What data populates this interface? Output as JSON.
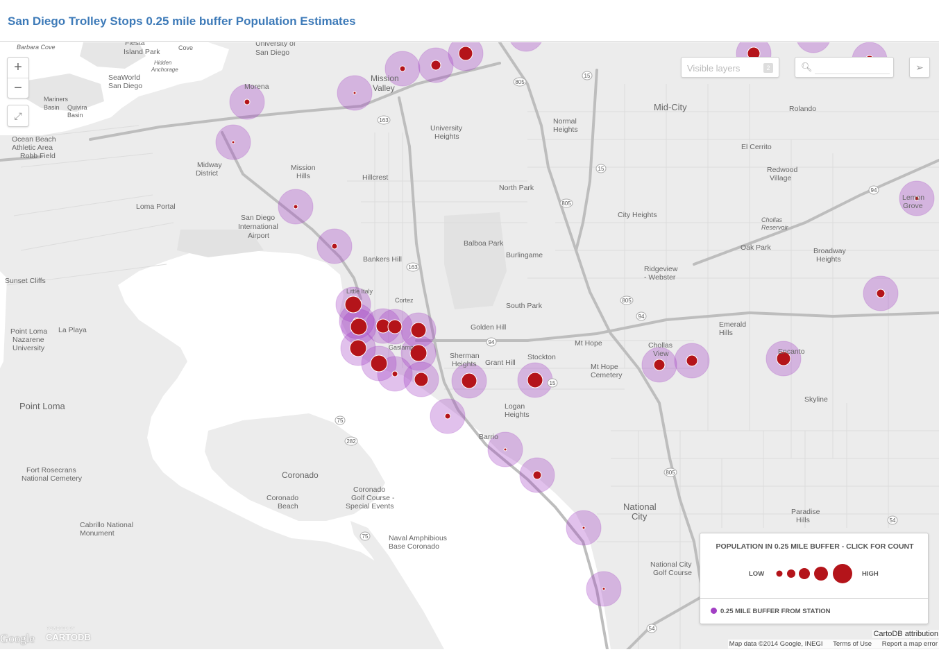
{
  "header": {
    "title": "San Diego Trolley Stops 0.25 mile buffer Population Estimates"
  },
  "controls": {
    "zoom_in": "+",
    "zoom_out": "−",
    "fullscreen": "⤢",
    "layers_label": "Visible layers",
    "layers_count": "2",
    "search_placeholder": "",
    "share": "➢"
  },
  "legend": {
    "title": "POPULATION IN 0.25 MILE BUFFER - CLICK FOR COUNT",
    "low": "LOW",
    "high": "HIGH",
    "buffer_label": "0.25 MILE BUFFER FROM STATION"
  },
  "colors": {
    "buffer": "#a23fc4",
    "population": "#b4141a",
    "road": "#b5b5b5",
    "water": "#ffffff",
    "land": "#ececec"
  },
  "attribution": {
    "google": "Google",
    "powered": "POWERED BY",
    "cartodb": "CARTODB",
    "cartodb_attr": "CartoDB attribution",
    "mapdata": "Map data ©2014 Google, INEGI",
    "terms": "Terms of Use",
    "report": "Report a map error"
  },
  "place_labels": [
    "Barbara Cove",
    "Fiesta Island Park",
    "Cove",
    "University of San Diego",
    "SeaWorld San Diego",
    "Mariners Basin",
    "Quivira Basin",
    "Hidden Anchorage",
    "Morena",
    "Mission Valley",
    "Ocean Beach Athletic Area Robb Field",
    "Midway District",
    "Mission Hills",
    "Hillcrest",
    "University Heights",
    "Normal Heights",
    "Mid-City",
    "North Park",
    "Loma Portal",
    "San Diego International Airport",
    "Balboa Park",
    "Burlingame",
    "City Heights",
    "Bankers Hill",
    "South Park",
    "Golden Hill",
    "Sherman Heights",
    "Grant Hill",
    "Stockton",
    "Mt Hope",
    "Mt Hope Cemetery",
    "Chollas View",
    "Sunset Cliffs",
    "Point Loma Nazarene University",
    "La Playa",
    "Point Loma",
    "Coronado",
    "Coronado Beach",
    "Coronado Golf Course - Special Events",
    "Fort Rosecrans National Cemetery",
    "Cabrillo National Monument",
    "Naval Amphibious Base Coronado",
    "National City",
    "National City Golf Course",
    "Logan Heights",
    "Barrio Logan",
    "Emerald Hills",
    "Ridgeview - Webster",
    "Oak Park",
    "Chollas Reservoir",
    "Broadway Heights",
    "Redwood Village",
    "El Cerrito",
    "Rolando",
    "Lemon Grove",
    "Encanto",
    "Paradise Hills",
    "Skyline",
    "Little Italy",
    "Cortez",
    "Gaslamp"
  ]
}
